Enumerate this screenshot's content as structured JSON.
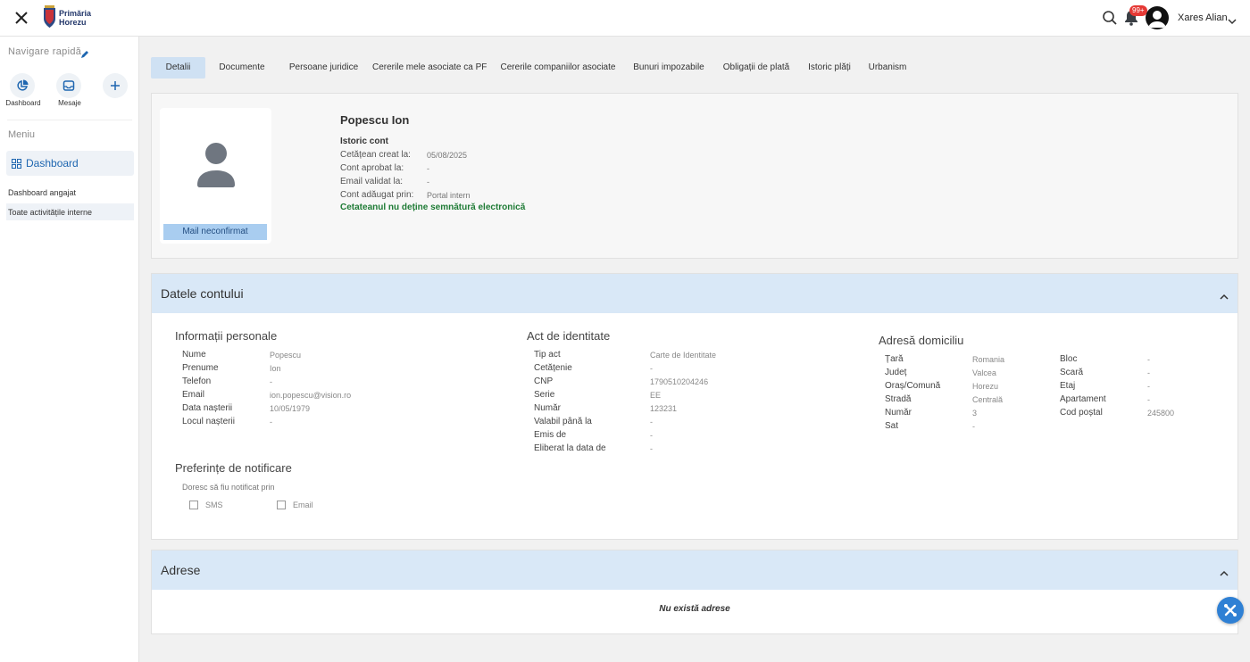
{
  "app": {
    "logo_line1": "Primăria",
    "logo_line2": "Horezu"
  },
  "header": {
    "notification_count": "99+",
    "user_name": "Xares Alian"
  },
  "sidebar": {
    "quick_nav_label": "Navigare rapidă",
    "quick_buttons": [
      {
        "label": "Dashboard",
        "icon": "pie-chart-icon"
      },
      {
        "label": "Mesaje",
        "icon": "inbox-icon"
      },
      {
        "label": "",
        "icon": "plus-icon"
      }
    ],
    "menu_label": "Meniu",
    "menu_items": [
      {
        "label": "Dashboard"
      },
      {
        "label": "Dashboard angajat"
      },
      {
        "label": "Toate activitățile interne"
      }
    ]
  },
  "tabs": [
    "Detalii",
    "Documente",
    "Persoane juridice",
    "Cererile mele asociate ca PF",
    "Cererile companiilor asociate",
    "Bunuri impozabile",
    "Obligații de plată",
    "Istoric plăți",
    "Urbanism"
  ],
  "profile": {
    "name": "Popescu Ion",
    "mail_status": "Mail neconfirmat",
    "history_title": "Istoric cont",
    "history": [
      {
        "label": "Cetățean creat la:",
        "value": "05/08/2025"
      },
      {
        "label": "Cont aprobat la:",
        "value": "-"
      },
      {
        "label": "Email validat la:",
        "value": "-"
      },
      {
        "label": "Cont adăugat prin:",
        "value": "Portal intern"
      }
    ],
    "signature_note": "Cetateanul nu deține semnătură electronică"
  },
  "account": {
    "panel_title": "Datele contului",
    "personal_title": "Informații personale",
    "personal": [
      {
        "label": "Nume",
        "value": "Popescu"
      },
      {
        "label": "Prenume",
        "value": "Ion"
      },
      {
        "label": "Telefon",
        "value": "-"
      },
      {
        "label": "Email",
        "value": "ion.popescu@vision.ro"
      },
      {
        "label": "Data nașterii",
        "value": "10/05/1979"
      },
      {
        "label": "Locul nașterii",
        "value": "-"
      }
    ],
    "identity_title": "Act de identitate",
    "identity": [
      {
        "label": "Tip act",
        "value": "Carte de Identitate"
      },
      {
        "label": "Cetățenie",
        "value": "-"
      },
      {
        "label": "CNP",
        "value": "1790510204246"
      },
      {
        "label": "Serie",
        "value": "EE"
      },
      {
        "label": "Număr",
        "value": "123231"
      },
      {
        "label": "Valabil până la",
        "value": "-"
      },
      {
        "label": "Emis de",
        "value": "-"
      },
      {
        "label": "Eliberat la data de",
        "value": "-"
      }
    ],
    "address_title": "Adresă domiciliu",
    "address_left": [
      {
        "label": "Țară",
        "value": "Romania"
      },
      {
        "label": "Județ",
        "value": "Valcea"
      },
      {
        "label": "Oraș/Comună",
        "value": "Horezu"
      },
      {
        "label": "Stradă",
        "value": "Centrală"
      },
      {
        "label": "Număr",
        "value": "3"
      },
      {
        "label": "Sat",
        "value": "-"
      }
    ],
    "address_right": [
      {
        "label": "Bloc",
        "value": "-"
      },
      {
        "label": "Scară",
        "value": "-"
      },
      {
        "label": "Etaj",
        "value": "-"
      },
      {
        "label": "Apartament",
        "value": "-"
      },
      {
        "label": "Cod poștal",
        "value": "245800"
      }
    ],
    "notif_title": "Preferințe de notificare",
    "notif_subtitle": "Doresc să fiu notificat prin",
    "notif_options": [
      {
        "label": "SMS",
        "checked": false
      },
      {
        "label": "Email",
        "checked": false
      }
    ]
  },
  "addresses": {
    "panel_title": "Adrese",
    "empty_message": "Nu există adrese"
  },
  "colors": {
    "accent": "#2f80d4",
    "panel_header": "#d9e8f7",
    "signature": "#1e7b35"
  }
}
